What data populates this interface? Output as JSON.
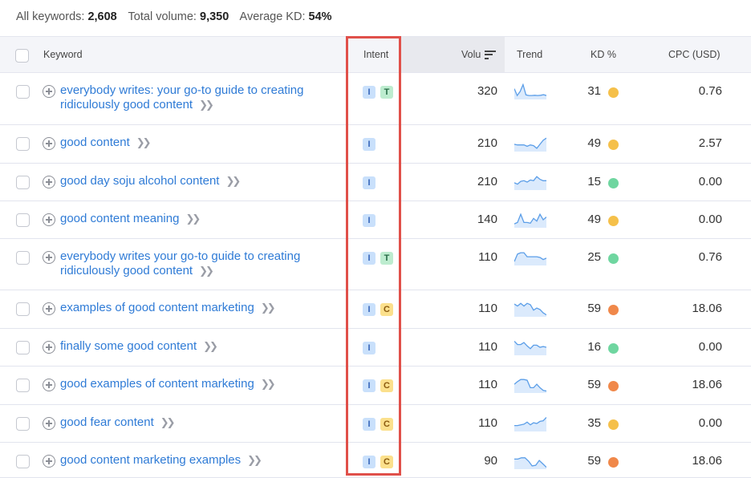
{
  "summary": {
    "all_keywords_label": "All keywords:",
    "all_keywords_value": "2,608",
    "total_volume_label": "Total volume:",
    "total_volume_value": "9,350",
    "average_kd_label": "Average KD:",
    "average_kd_value": "54%"
  },
  "columns": {
    "keyword": "Keyword",
    "intent": "Intent",
    "volume": "Volu",
    "trend": "Trend",
    "kd": "KD %",
    "cpc": "CPC (USD)"
  },
  "colors": {
    "link": "#2f7bd6",
    "highlight": "#e0504a",
    "kd_easy": "#6fd6a0",
    "kd_medium": "#f5c04a",
    "kd_hard": "#f0884a",
    "trend_line": "#5b9ee8",
    "trend_fill": "#dbeafc"
  },
  "rows": [
    {
      "keyword": "everybody writes: your go-to guide to creating ridiculously good content",
      "intents": [
        "I",
        "T"
      ],
      "volume": "320",
      "kd": "31",
      "kd_level": "medium",
      "cpc": "0.76",
      "trend": [
        0.7,
        0.2,
        0.5,
        1.0,
        0.25,
        0.2,
        0.2,
        0.22,
        0.2,
        0.22,
        0.26,
        0.2
      ]
    },
    {
      "keyword": "good content",
      "intents": [
        "I"
      ],
      "volume": "210",
      "kd": "49",
      "kd_level": "medium",
      "cpc": "2.57",
      "trend": [
        0.45,
        0.4,
        0.4,
        0.4,
        0.3,
        0.4,
        0.35,
        0.15,
        0.45,
        0.75,
        0.9
      ]
    },
    {
      "keyword": "good day soju alcohol content",
      "intents": [
        "I"
      ],
      "volume": "210",
      "kd": "15",
      "kd_level": "easy",
      "cpc": "0.00",
      "trend": [
        0.45,
        0.35,
        0.55,
        0.6,
        0.5,
        0.65,
        0.6,
        0.9,
        0.7,
        0.6,
        0.6
      ]
    },
    {
      "keyword": "good content meaning",
      "intents": [
        "I"
      ],
      "volume": "140",
      "kd": "49",
      "kd_level": "medium",
      "cpc": "0.00",
      "trend": [
        0.2,
        0.3,
        0.9,
        0.3,
        0.3,
        0.25,
        0.6,
        0.4,
        0.9,
        0.5,
        0.7
      ]
    },
    {
      "keyword": "everybody writes your go-to guide to creating ridiculously good content",
      "intents": [
        "I",
        "T"
      ],
      "volume": "110",
      "kd": "25",
      "kd_level": "easy",
      "cpc": "0.76",
      "trend": [
        0.2,
        0.75,
        0.85,
        0.85,
        0.55,
        0.55,
        0.55,
        0.55,
        0.5,
        0.35,
        0.45
      ]
    },
    {
      "keyword": "examples of good content marketing",
      "intents": [
        "I",
        "C"
      ],
      "volume": "110",
      "kd": "59",
      "kd_level": "hard",
      "cpc": "18.06",
      "trend": [
        0.85,
        0.7,
        0.9,
        0.7,
        0.9,
        0.8,
        0.4,
        0.55,
        0.45,
        0.2,
        0.05
      ]
    },
    {
      "keyword": "finally some good content",
      "intents": [
        "I"
      ],
      "volume": "110",
      "kd": "16",
      "kd_level": "easy",
      "cpc": "0.00",
      "trend": [
        0.95,
        0.7,
        0.7,
        0.85,
        0.6,
        0.4,
        0.65,
        0.65,
        0.5,
        0.55,
        0.5
      ]
    },
    {
      "keyword": "good examples of content marketing",
      "intents": [
        "I",
        "C"
      ],
      "volume": "110",
      "kd": "59",
      "kd_level": "hard",
      "cpc": "18.06",
      "trend": [
        0.55,
        0.75,
        0.9,
        0.9,
        0.85,
        0.3,
        0.3,
        0.55,
        0.3,
        0.1,
        0.05
      ]
    },
    {
      "keyword": "good fear content",
      "intents": [
        "I",
        "C"
      ],
      "volume": "110",
      "kd": "35",
      "kd_level": "medium",
      "cpc": "0.00",
      "trend": [
        0.35,
        0.35,
        0.4,
        0.45,
        0.6,
        0.4,
        0.55,
        0.5,
        0.65,
        0.7,
        0.95
      ]
    },
    {
      "keyword": "good content marketing examples",
      "intents": [
        "I",
        "C"
      ],
      "volume": "90",
      "kd": "59",
      "kd_level": "hard",
      "cpc": "18.06",
      "trend": [
        0.65,
        0.65,
        0.75,
        0.75,
        0.5,
        0.15,
        0.2,
        0.55,
        0.3,
        0.05
      ]
    }
  ]
}
